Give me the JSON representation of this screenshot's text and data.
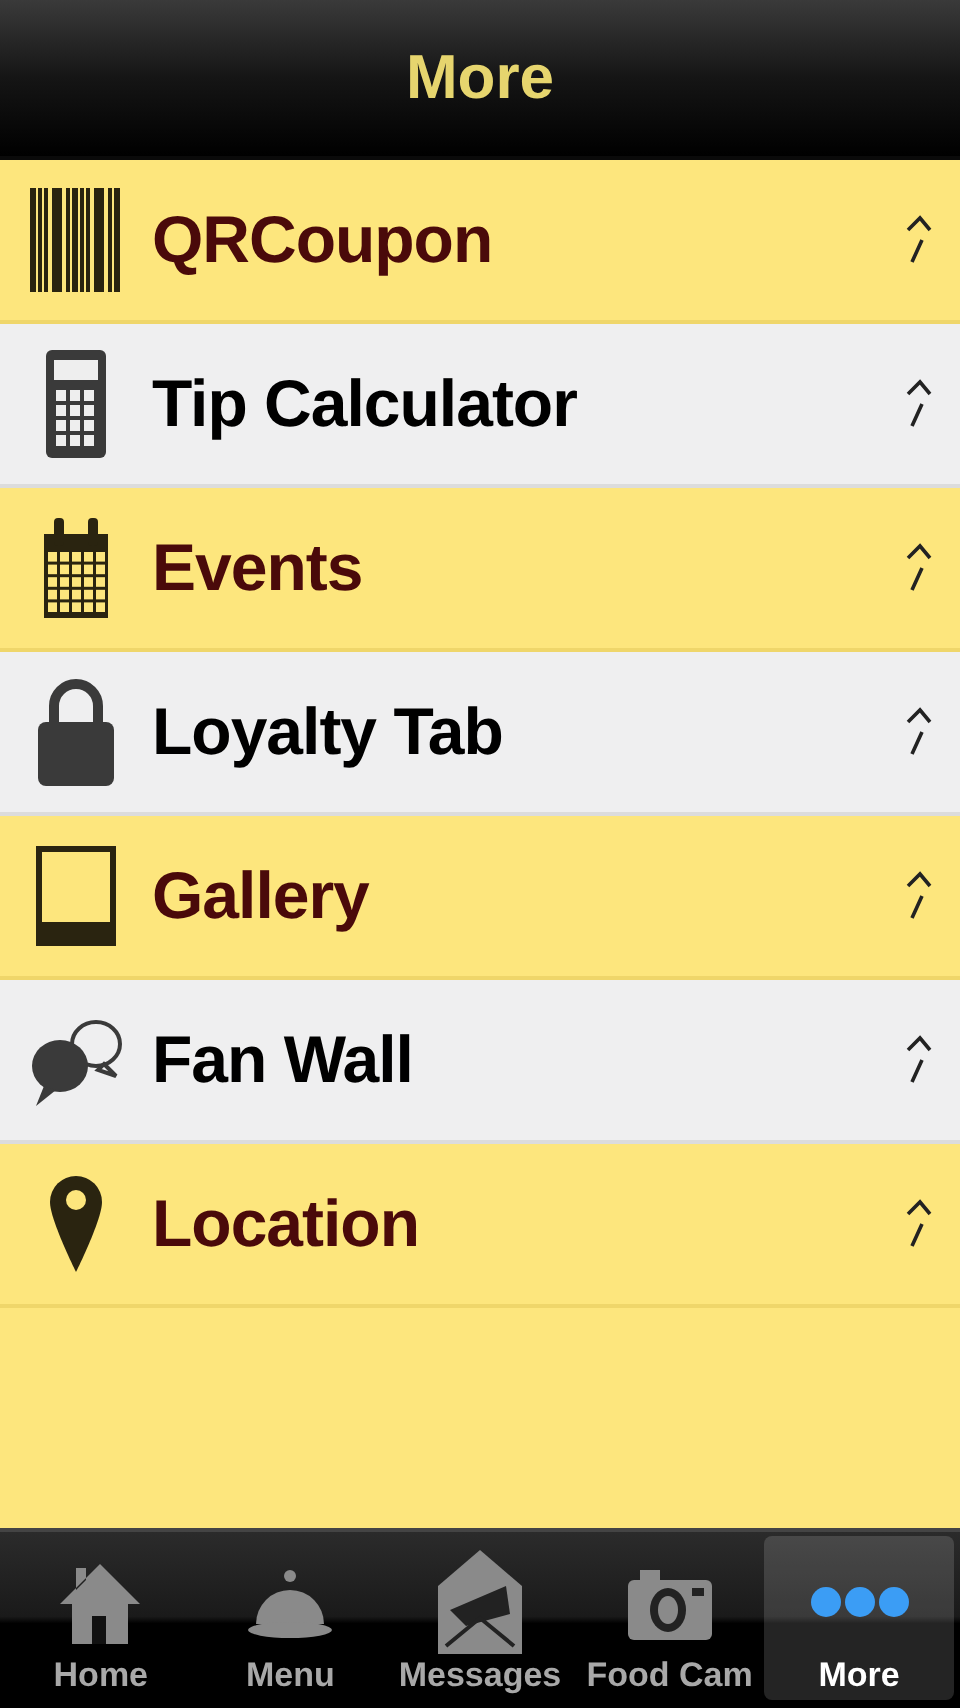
{
  "header": {
    "title": "More"
  },
  "items": [
    {
      "label": "QRCoupon",
      "kind": "barcode"
    },
    {
      "label": "Tip Calculator",
      "kind": "calculator"
    },
    {
      "label": "Events",
      "kind": "calendar"
    },
    {
      "label": "Loyalty Tab",
      "kind": "lock"
    },
    {
      "label": "Gallery",
      "kind": "frame"
    },
    {
      "label": "Fan Wall",
      "kind": "chat"
    },
    {
      "label": "Location",
      "kind": "pin"
    }
  ],
  "tab_bar": [
    {
      "label": "Home",
      "kind": "home",
      "selected": false
    },
    {
      "label": "Menu",
      "kind": "cloche",
      "selected": false
    },
    {
      "label": "Messages",
      "kind": "envelope",
      "selected": false
    },
    {
      "label": "Food Cam",
      "kind": "camera",
      "selected": false
    },
    {
      "label": "More",
      "kind": "dots",
      "selected": true
    }
  ]
}
